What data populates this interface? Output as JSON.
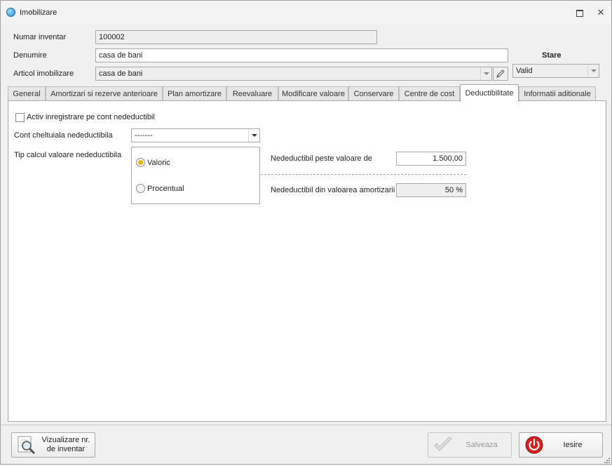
{
  "window": {
    "title": "Imobilizare"
  },
  "form": {
    "numar_label": "Numar inventar",
    "numar_value": "100002",
    "denumire_label": "Denumire",
    "denumire_value": "casa de bani",
    "articol_label": "Articol imobilizare",
    "articol_value": "casa de bani"
  },
  "stare": {
    "title": "Stare",
    "value": "Valid"
  },
  "tabs": [
    {
      "label": "General"
    },
    {
      "label": "Amortizari si rezerve anterioare"
    },
    {
      "label": "Plan amortizare"
    },
    {
      "label": "Reevaluare"
    },
    {
      "label": "Modificare valoare"
    },
    {
      "label": "Conservare"
    },
    {
      "label": "Centre de cost"
    },
    {
      "label": "Deductibilitate",
      "active": true
    },
    {
      "label": "Informatii aditionale"
    }
  ],
  "deductibilitate": {
    "checkbox_label": "Activ inregistrare pe cont nedeductibil",
    "checkbox_checked": false,
    "cont_label": "Cont cheltuiala nedeductibila",
    "cont_value": "-------",
    "tip_label": "Tip calcul valoare nedeductibila",
    "radio_valoric": "Valoric",
    "radio_procentual": "Procentual",
    "selected": "Valoric",
    "peste_label": "Nedeductibil peste valoare de",
    "peste_value": "1.500,00",
    "din_label": "Nedeductibil din valoarea amortizarii",
    "din_value": "50 %"
  },
  "buttons": {
    "vizualizare_line1": "Vizualizare nr.",
    "vizualizare_line2": "de inventar",
    "salveaza": "Salveaza",
    "iesire": "Iesire"
  },
  "colors": {
    "radio_selected": "#f0b400",
    "iesire_icon": "#d42020",
    "accent_icon": "#1e88d0"
  }
}
